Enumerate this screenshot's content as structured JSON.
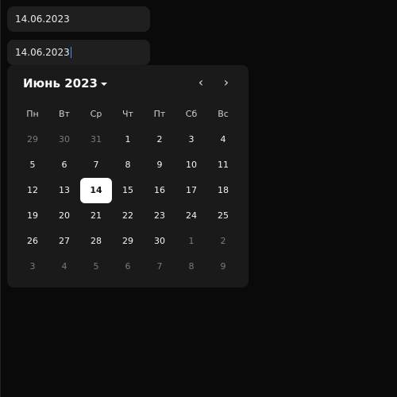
{
  "inputs": [
    {
      "value": "14.06.2023"
    },
    {
      "value": "14.06.2023"
    }
  ],
  "calendar": {
    "month_label": "Июнь 2023",
    "prev_label": "‹",
    "next_label": "›",
    "weekdays": [
      "Пн",
      "Вт",
      "Ср",
      "Чт",
      "Пт",
      "Сб",
      "Вс"
    ],
    "selected_day": "14",
    "weeks": [
      [
        {
          "d": "29",
          "other": true
        },
        {
          "d": "30",
          "other": true
        },
        {
          "d": "31",
          "other": true
        },
        {
          "d": "1"
        },
        {
          "d": "2"
        },
        {
          "d": "3"
        },
        {
          "d": "4"
        }
      ],
      [
        {
          "d": "5"
        },
        {
          "d": "6"
        },
        {
          "d": "7"
        },
        {
          "d": "8"
        },
        {
          "d": "9"
        },
        {
          "d": "10"
        },
        {
          "d": "11"
        }
      ],
      [
        {
          "d": "12"
        },
        {
          "d": "13"
        },
        {
          "d": "14",
          "selected": true
        },
        {
          "d": "15"
        },
        {
          "d": "16"
        },
        {
          "d": "17"
        },
        {
          "d": "18"
        }
      ],
      [
        {
          "d": "19"
        },
        {
          "d": "20"
        },
        {
          "d": "21"
        },
        {
          "d": "22"
        },
        {
          "d": "23"
        },
        {
          "d": "24"
        },
        {
          "d": "25"
        }
      ],
      [
        {
          "d": "26"
        },
        {
          "d": "27"
        },
        {
          "d": "28"
        },
        {
          "d": "29"
        },
        {
          "d": "30"
        },
        {
          "d": "1",
          "other": true
        },
        {
          "d": "2",
          "other": true
        }
      ],
      [
        {
          "d": "3",
          "other": true
        },
        {
          "d": "4",
          "other": true
        },
        {
          "d": "5",
          "other": true
        },
        {
          "d": "6",
          "other": true
        },
        {
          "d": "7",
          "other": true
        },
        {
          "d": "8",
          "other": true
        },
        {
          "d": "9",
          "other": true
        }
      ]
    ]
  },
  "colors": {
    "background": "#0a0a0a",
    "input_bg": "#1f1f1f",
    "panel_bg": "#1a1a1a",
    "selected_bg": "#ffffff",
    "caret": "#4c8dff"
  }
}
